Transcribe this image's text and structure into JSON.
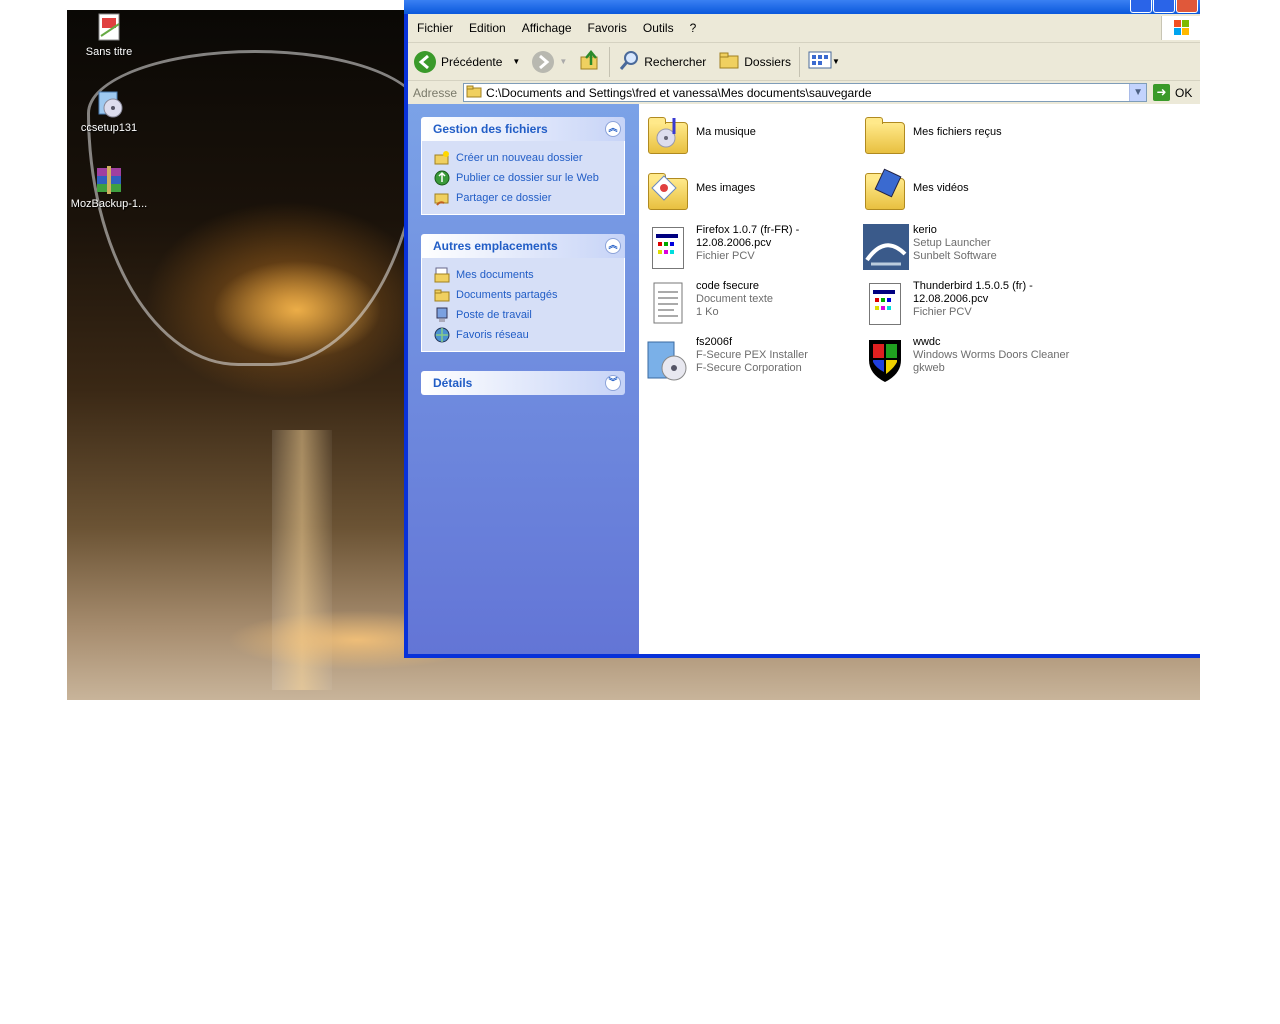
{
  "desktop": {
    "icons": [
      {
        "label": "Sans titre",
        "icon": "paint-image-icon"
      },
      {
        "label": "ccsetup131",
        "icon": "setup-installer-icon"
      },
      {
        "label": "MozBackup-1...",
        "icon": "winrar-archive-icon"
      }
    ]
  },
  "menubar": {
    "items": [
      "Fichier",
      "Edition",
      "Affichage",
      "Favoris",
      "Outils",
      "?"
    ]
  },
  "toolbar": {
    "back_label": "Précédente",
    "search_label": "Rechercher",
    "folders_label": "Dossiers"
  },
  "address": {
    "label": "Adresse",
    "value": "C:\\Documents and Settings\\fred et vanessa\\Mes documents\\sauvegarde",
    "go_label": "OK"
  },
  "tasks": {
    "file_tasks": {
      "title": "Gestion des fichiers",
      "items": [
        "Créer un nouveau dossier",
        "Publier ce dossier sur le Web",
        "Partager ce dossier"
      ]
    },
    "other_places": {
      "title": "Autres emplacements",
      "items": [
        "Mes documents",
        "Documents partagés",
        "Poste de travail",
        "Favoris réseau"
      ]
    },
    "details": {
      "title": "Détails"
    }
  },
  "files": [
    {
      "name": "Ma musique",
      "line2": "",
      "line3": "",
      "icon": "music-folder-icon"
    },
    {
      "name": "Mes fichiers reçus",
      "line2": "",
      "line3": "",
      "icon": "folder-icon"
    },
    {
      "name": "Mes images",
      "line2": "",
      "line3": "",
      "icon": "pictures-folder-icon"
    },
    {
      "name": "Mes vidéos",
      "line2": "",
      "line3": "",
      "icon": "videos-folder-icon"
    },
    {
      "name": "Firefox 1.0.7 (fr-FR) - 12.08.2006.pcv",
      "line2": "Fichier PCV",
      "line3": "",
      "icon": "pcv-file-icon"
    },
    {
      "name": "kerio",
      "line2": "Setup Launcher",
      "line3": "Sunbelt Software",
      "icon": "kerio-setup-icon"
    },
    {
      "name": "code fsecure",
      "line2": "Document texte",
      "line3": "1 Ko",
      "icon": "text-document-icon"
    },
    {
      "name": "Thunderbird 1.5.0.5 (fr) - 12.08.2006.pcv",
      "line2": "Fichier PCV",
      "line3": "",
      "icon": "pcv-file-icon"
    },
    {
      "name": "fs2006f",
      "line2": "F-Secure PEX Installer",
      "line3": "F-Secure Corporation",
      "icon": "installer-icon"
    },
    {
      "name": "wwdc",
      "line2": "Windows Worms Doors Cleaner",
      "line3": "gkweb",
      "icon": "wwdc-shield-icon"
    }
  ],
  "colors": {
    "xp_blue": "#0831d9",
    "task_link": "#215dc6",
    "toolbar_bg": "#ece9d8"
  }
}
